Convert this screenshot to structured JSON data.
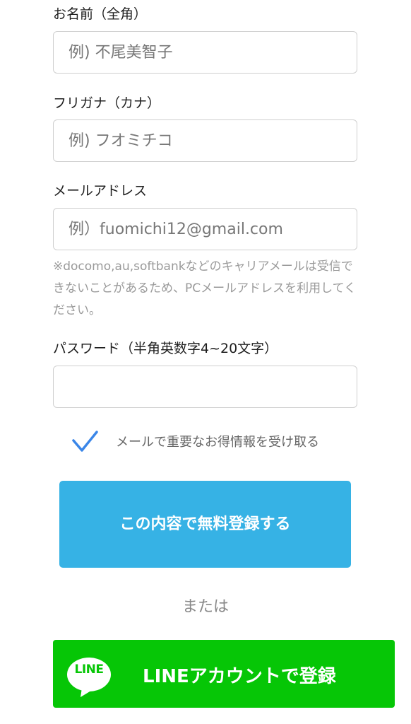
{
  "form": {
    "name": {
      "label": "お名前（全角）",
      "placeholder": "例) 不尾美智子",
      "value": ""
    },
    "kana": {
      "label": "フリガナ（カナ）",
      "placeholder": "例) フオミチコ",
      "value": ""
    },
    "email": {
      "label": "メールアドレス",
      "placeholder": "例）fuomichi12@gmail.com",
      "value": "",
      "note": "※docomo,au,softbankなどのキャリアメールは受信できないことがあるため、PCメールアドレスを利用してください。"
    },
    "password": {
      "label": "パスワード（半角英数字4~20文字）",
      "placeholder": "",
      "value": ""
    },
    "optin": {
      "label": "メールで重要なお得情報を受け取る",
      "checked": true,
      "icon": "checkmark-icon"
    },
    "submit_label": "この内容で無料登録する",
    "or_label": "または",
    "line_button": {
      "logo_text": "LINE",
      "label": "LINEアカウントで登録",
      "icon": "line-logo-icon"
    }
  },
  "colors": {
    "submit_bg": "#36b2e5",
    "line_bg": "#06c606",
    "checkmark": "#3a86e8",
    "input_border": "#cfcfcf",
    "placeholder": "#777777",
    "note_text": "#9a9a9a"
  }
}
